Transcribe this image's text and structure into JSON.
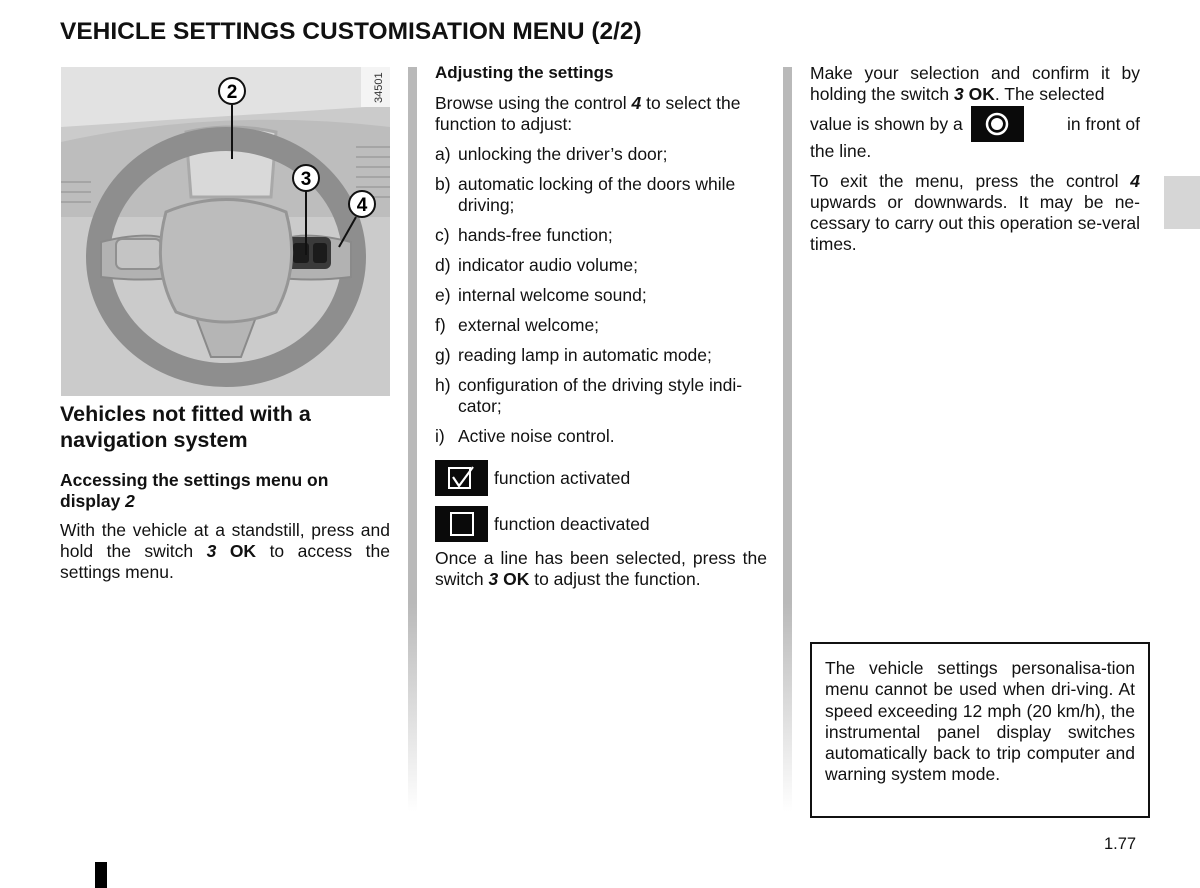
{
  "page": {
    "title": "VEHICLE SETTINGS CUSTOMISATION MENU (2/2)",
    "page_number": "1.77"
  },
  "figure": {
    "code": "34501",
    "callouts": [
      "2",
      "3",
      "4"
    ]
  },
  "left": {
    "section_heading": "Vehicles not fitted with a navigation system",
    "sub_heading_text": "Accessing the settings menu on display ",
    "sub_heading_num": "2",
    "body_pre": "With the vehicle at a standstill, press and hold the switch ",
    "body_ref": "3",
    "body_ok": "OK",
    "body_post": " to access the settings menu."
  },
  "middle": {
    "heading": "Adjusting the settings",
    "intro_pre": "Browse using the control ",
    "intro_ref": "4",
    "intro_post": " to select the function to adjust:",
    "items": [
      {
        "marker": "a)",
        "text": "unlocking the driver’s door;"
      },
      {
        "marker": "b)",
        "text": "automatic locking of the doors while driving;"
      },
      {
        "marker": "c)",
        "text": "hands-free function;"
      },
      {
        "marker": "d)",
        "text": "indicator audio volume;"
      },
      {
        "marker": "e)",
        "text": "internal welcome sound;"
      },
      {
        "marker": "f)",
        "text": "external welcome;"
      },
      {
        "marker": "g)",
        "text": "reading lamp in automatic mode;"
      },
      {
        "marker": "h)",
        "text": "configuration of the driving style indi-cator;"
      },
      {
        "marker": "i)",
        "text": "Active noise control."
      }
    ],
    "legend_activated": "function activated",
    "legend_deactivated": "function deactivated",
    "after_pre": "Once a line has been selected, press the switch ",
    "after_ref": "3",
    "after_ok": "OK",
    "after_post": " to adjust the function."
  },
  "right": {
    "p1_pre": "Make your selection and confirm it by holding the switch ",
    "p1_ref": "3",
    "p1_ok": "OK",
    "p1_post": ". The selected",
    "p1b_pre": "value is shown by a",
    "p1b_post": "in front of",
    "p1c": "the line.",
    "p2_pre": "To exit the menu, press the control ",
    "p2_ref": "4",
    "p2_post": " upwards or downwards. It may be ne-cessary to carry out this operation se-veral times.",
    "note": "The vehicle settings personalisa-tion menu cannot be used when dri-ving. At speed exceeding 12 mph (20 km/h), the instrumental panel display switches automatically back to trip computer and warning system mode."
  },
  "icons": {
    "activated": "checkbox-checked-icon",
    "deactivated": "checkbox-empty-icon",
    "selected_value": "radio-selected-icon"
  }
}
